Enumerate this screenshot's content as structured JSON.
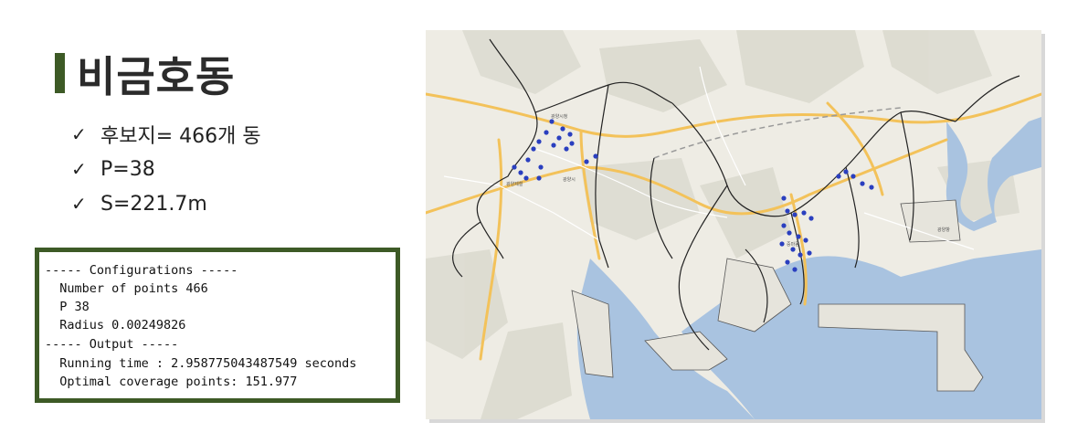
{
  "slide": {
    "title": "비금호동",
    "accent_color": "#3d5a26"
  },
  "bullets": [
    {
      "icon": "check-mark-icon",
      "text": "후보지= 466개 동"
    },
    {
      "icon": "check-mark-icon",
      "text": "P=38"
    },
    {
      "icon": "check-mark-icon",
      "text": "S=221.7m"
    }
  ],
  "console": {
    "lines": [
      "----- Configurations -----",
      "  Number of points 466",
      "  P 38",
      "  Radius 0.00249826",
      "----- Output -----",
      "  Running time : 2.958775043487549 seconds",
      "  Optimal coverage points: 151.977"
    ]
  },
  "map": {
    "land_color": "#eeece4",
    "water_color": "#a9c3e0",
    "road_color": "#f3c25a",
    "point_color": "#2a3fbf",
    "labels": [
      "광양시청",
      "광양제철",
      "광양시",
      "중마동",
      "광양항"
    ]
  }
}
